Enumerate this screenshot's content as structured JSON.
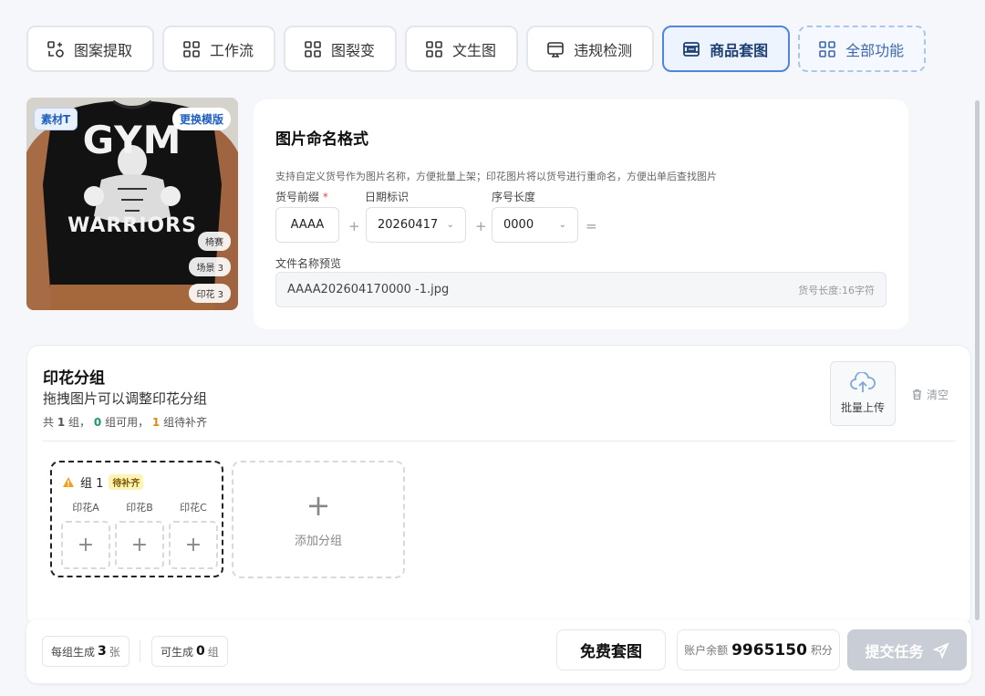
{
  "tabs": [
    {
      "label": "图案提取",
      "icon": "pattern-extract-icon"
    },
    {
      "label": "工作流",
      "icon": "grid-icon"
    },
    {
      "label": "图裂变",
      "icon": "grid-icon"
    },
    {
      "label": "文生图",
      "icon": "grid-icon"
    },
    {
      "label": "违规检测",
      "icon": "monitor-icon"
    },
    {
      "label": "商品套图",
      "icon": "product-set-icon",
      "active": true
    },
    {
      "label": "全部功能",
      "icon": "grid-icon"
    }
  ],
  "template": {
    "material_badge": "素材T",
    "change_button": "更换模版",
    "tags": [
      "椅赛",
      "场景 3",
      "印花 3"
    ],
    "print_line1": "GYM",
    "print_line2": "WARRIORS"
  },
  "naming": {
    "title": "图片命名格式",
    "desc": "支持自定义货号作为图片名称，方便批量上架；印花图片将以货号进行重命名，方便出单后查找图片",
    "prefix_label": "货号前缀",
    "required_mark": "*",
    "date_label": "日期标识",
    "seq_label": "序号长度",
    "prefix_value": "AAAA",
    "date_value": "20260417",
    "seq_value": "0000",
    "plus": "+",
    "equals": "=",
    "preview_label": "文件名称预览",
    "preview_value": "AAAA202604170000 -1.jpg",
    "preview_len": "货号长度:16字符"
  },
  "groups": {
    "title": "印花分组",
    "subtitle": "拖拽图片可以调整印花分组",
    "stats_prefix": "共",
    "stats_total": "1",
    "stats_total_unit": "组，",
    "stats_avail": "0",
    "stats_avail_unit": "组可用，",
    "stats_pending": "1",
    "stats_pending_unit": "组待补齐",
    "upload_label": "批量上传",
    "clear_label": "清空",
    "group_name": "组 1",
    "group_status": "待补齐",
    "slots": [
      "印花A",
      "印花B",
      "印花C"
    ],
    "add_group": "添加分组"
  },
  "bottom": {
    "per_group_label": "每组生成",
    "per_group_value": "3",
    "per_group_unit": "张",
    "can_gen_label": "可生成",
    "can_gen_value": "0",
    "can_gen_unit": "组",
    "free_button": "免费套图",
    "balance_label": "账户余额",
    "balance_value": "9965150",
    "balance_unit": "积分",
    "submit": "提交任务"
  },
  "colors": {
    "accent": "#4f86d9",
    "success": "#1a9a63",
    "warning": "#d98a1a"
  }
}
